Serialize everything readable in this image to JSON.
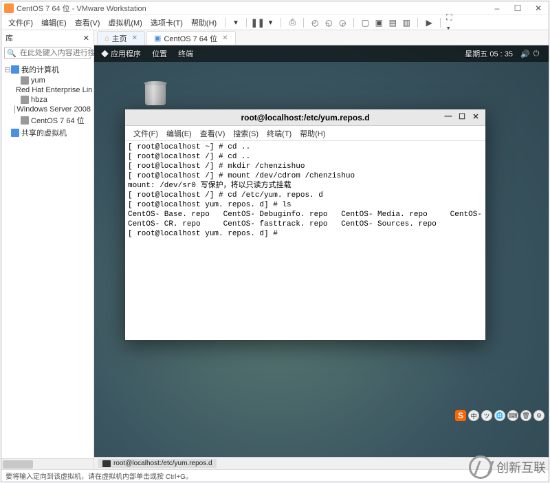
{
  "window": {
    "title": "CentOS 7 64 位 - VMware Workstation",
    "controls": {
      "min": "–",
      "max": "☐",
      "close": "✕"
    }
  },
  "menubar": {
    "file": "文件(F)",
    "edit": "编辑(E)",
    "view": "查看(V)",
    "vm": "虚拟机(M)",
    "tabs": "选项卡(T)",
    "help": "帮助(H)"
  },
  "sidebar": {
    "title": "库",
    "search_placeholder": "在此处键入内容进行搜索",
    "tree": {
      "root": "我的计算机",
      "items": [
        "yum",
        "Red Hat Enterprise Lin",
        "hbza",
        "Windows Server 2008",
        "CentOS 7 64 位"
      ],
      "shared": "共享的虚拟机"
    }
  },
  "tabs": {
    "home": "主页",
    "vm": "CentOS 7 64 位"
  },
  "gnome_bar": {
    "apps": "应用程序",
    "places": "位置",
    "terminal": "终端",
    "day": "星期五",
    "time": "05 : 35"
  },
  "terminal": {
    "title": "root@localhost:/etc/yum.repos.d",
    "menu": {
      "file": "文件(F)",
      "edit": "编辑(E)",
      "view": "查看(V)",
      "search": "搜索(S)",
      "terminal": "终端(T)",
      "help": "帮助(H)"
    },
    "lines": [
      "[ root@localhost ~] # cd ..",
      "[ root@localhost /] # cd ..",
      "[ root@localhost /] # mkdir /chenzishuo",
      "[ root@localhost /] # mount /dev/cdrom /chenzishuo",
      "mount: /dev/sr0 写保护，将以只读方式挂载",
      "[ root@localhost /] # cd /etc/yum. repos. d",
      "[ root@localhost yum. repos. d] # ls",
      "CentOS- Base. repo   CentOS- Debuginfo. repo   CentOS- Media. repo     CentOS- Vault. repo",
      "CentOS- CR. repo     CentOS- fasttrack. repo   CentOS- Sources. repo",
      "[ root@localhost yum. repos. d] # "
    ],
    "controls": {
      "min": "—",
      "max": "☐",
      "close": "✕"
    }
  },
  "taskbar_item": "root@localhost:/etc/yum.repos.d",
  "statusbar": "要将输入定向到该虚拟机，请在虚拟机内部单击或按 Ctrl+G。",
  "ime": {
    "zh": "中"
  },
  "watermark": "创新互联"
}
